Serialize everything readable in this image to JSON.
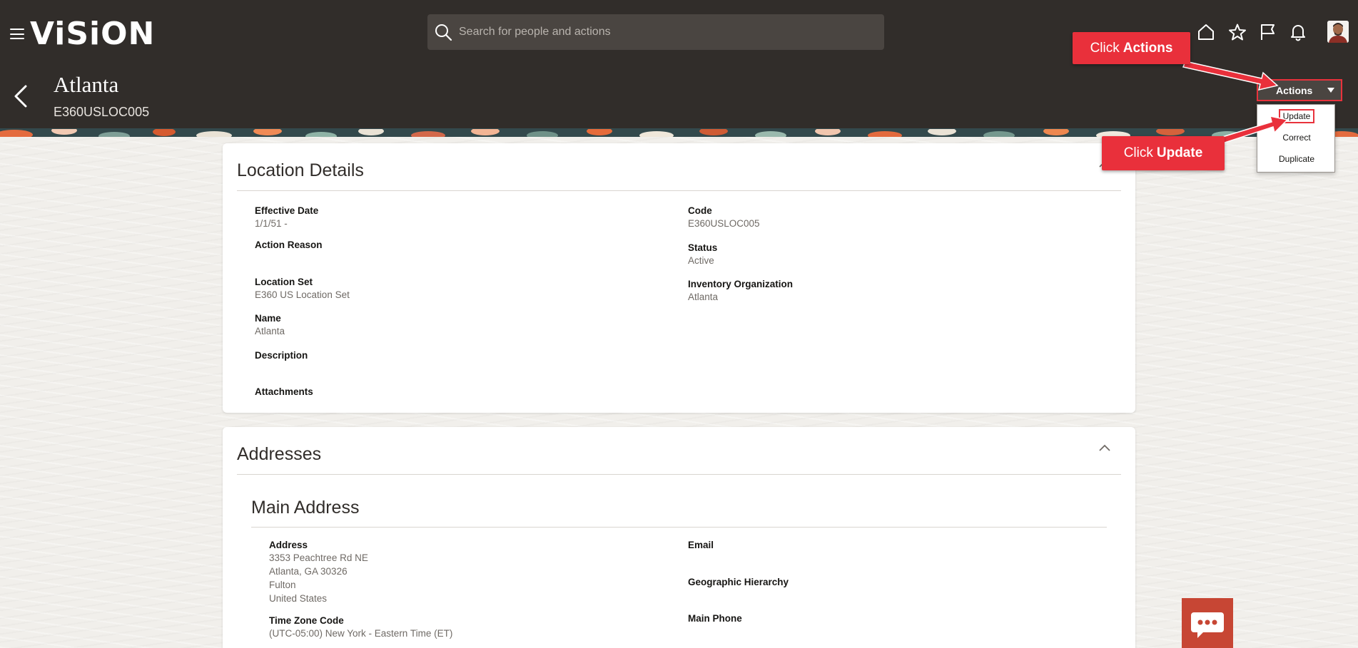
{
  "header": {
    "logo": "ViSiON",
    "search_placeholder": "Search for people and actions",
    "icons": [
      "home-icon",
      "favorites-star-icon",
      "flag-icon",
      "notifications-bell-icon"
    ]
  },
  "page": {
    "title": "Atlanta",
    "subtitle": "E360USLOC005"
  },
  "actions": {
    "button_label": "Actions",
    "menu": [
      "Update",
      "Correct",
      "Duplicate"
    ],
    "highlighted": "Update"
  },
  "callouts": {
    "actions": {
      "prefix": "Click",
      "bold": "Actions"
    },
    "update": {
      "prefix": "Click",
      "bold": "Update"
    }
  },
  "location_details": {
    "title": "Location Details",
    "left": [
      {
        "label": "Effective Date",
        "value": "1/1/51 -"
      },
      {
        "label": "Action Reason",
        "value": ""
      },
      {
        "label": "Location Set",
        "value": "E360 US Location Set"
      },
      {
        "label": "Name",
        "value": "Atlanta"
      },
      {
        "label": "Description",
        "value": ""
      },
      {
        "label": "Attachments",
        "value": ""
      }
    ],
    "right": [
      {
        "label": "Code",
        "value": "E360USLOC005"
      },
      {
        "label": "Status",
        "value": "Active"
      },
      {
        "label": "Inventory Organization",
        "value": "Atlanta"
      }
    ]
  },
  "addresses": {
    "title": "Addresses",
    "main_address_title": "Main Address",
    "left": [
      {
        "label": "Address",
        "lines": [
          "3353 Peachtree Rd NE",
          "Atlanta, GA 30326",
          "Fulton",
          "United States"
        ]
      },
      {
        "label": "Time Zone Code",
        "lines": [
          "(UTC-05:00) New York - Eastern Time (ET)"
        ]
      }
    ],
    "right": [
      {
        "label": "Email",
        "lines": []
      },
      {
        "label": "Geographic Hierarchy",
        "lines": []
      },
      {
        "label": "Main Phone",
        "lines": []
      }
    ]
  },
  "colors": {
    "header_bg": "#312d2a",
    "callout_red": "#e9303b",
    "chat_button": "#c74634"
  }
}
